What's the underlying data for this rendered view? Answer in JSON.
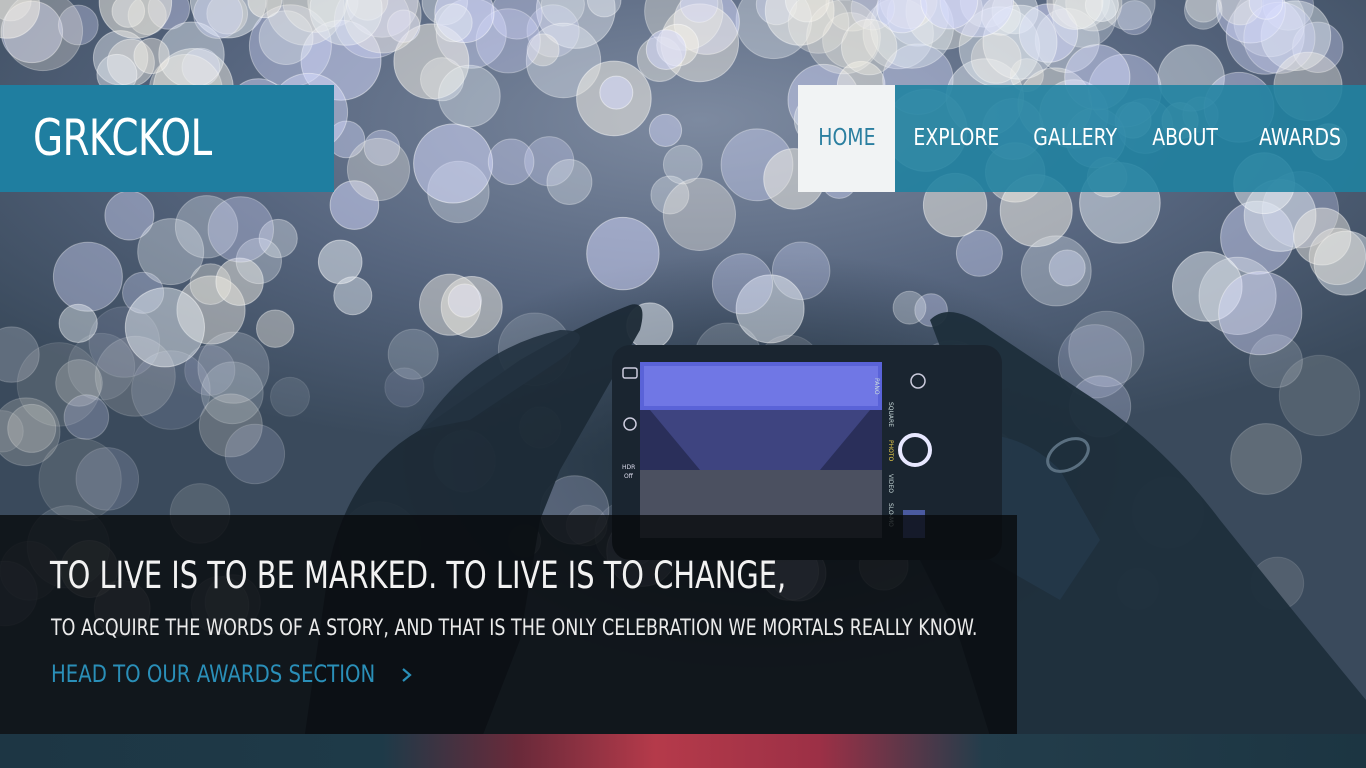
{
  "site": {
    "logo": "GRKCKOL"
  },
  "nav": {
    "items": [
      {
        "label": "HOME",
        "active": true
      },
      {
        "label": "EXPLORE",
        "active": false
      },
      {
        "label": "GALLERY",
        "active": false
      },
      {
        "label": "ABOUT",
        "active": false
      },
      {
        "label": "AWARDS",
        "active": false
      }
    ]
  },
  "hero": {
    "title": "TO LIVE IS TO BE MARKED. TO LIVE IS TO CHANGE,",
    "subtitle": "TO ACQUIRE THE WORDS OF A STORY, AND THAT IS THE ONLY CELEBRATION WE MORTALS REALLY KNOW.",
    "link_label": "HEAD TO OUR AWARDS SECTION",
    "link_icon": "chevron-right-icon"
  },
  "phone_screen": {
    "modes": [
      "SLO-MO",
      "VIDEO",
      "PHOTO",
      "SQUARE",
      "PANO"
    ],
    "hdr_label": "HDR",
    "hdr_state": "Off"
  },
  "colors": {
    "brand": "#1f7ea0",
    "nav_bg": "#1f82a0",
    "active_nav_bg": "#f1f3f4",
    "active_nav_text": "#2b7fa0",
    "link": "#2a8fb8",
    "caption_bg": "#080a0c"
  }
}
